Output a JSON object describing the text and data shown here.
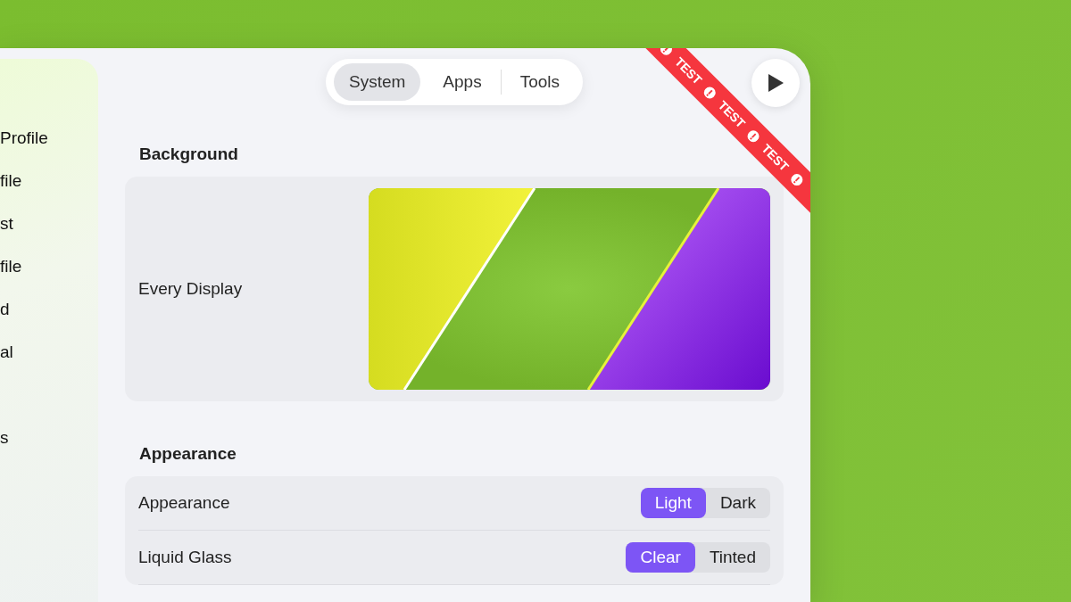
{
  "sidebar": {
    "items": [
      {
        "kind": "item",
        "label": "Profile"
      },
      {
        "kind": "item",
        "label": "file"
      },
      {
        "kind": "item",
        "label": "st"
      },
      {
        "kind": "item",
        "label": "file"
      },
      {
        "kind": "item",
        "label": "d"
      },
      {
        "kind": "item",
        "label": "al"
      },
      {
        "kind": "blank"
      },
      {
        "kind": "item",
        "label": "s"
      }
    ]
  },
  "tabs": [
    {
      "label": "System",
      "selected": true
    },
    {
      "label": "Apps",
      "selected": false
    },
    {
      "label": "Tools",
      "selected": false
    }
  ],
  "ribbon": {
    "labels": [
      "TEST",
      "TEST",
      "TEST"
    ]
  },
  "sections": [
    {
      "title": "Background",
      "kind": "wallpaper",
      "rows": [
        {
          "label": "Every Display"
        }
      ]
    },
    {
      "title": "Appearance",
      "kind": "options",
      "rows": [
        {
          "label": "Appearance",
          "options": [
            {
              "label": "Light",
              "selected": true
            },
            {
              "label": "Dark",
              "selected": false
            }
          ]
        },
        {
          "label": "Liquid Glass",
          "options": [
            {
              "label": "Clear",
              "selected": true
            },
            {
              "label": "Tinted",
              "selected": false
            }
          ]
        }
      ]
    }
  ]
}
